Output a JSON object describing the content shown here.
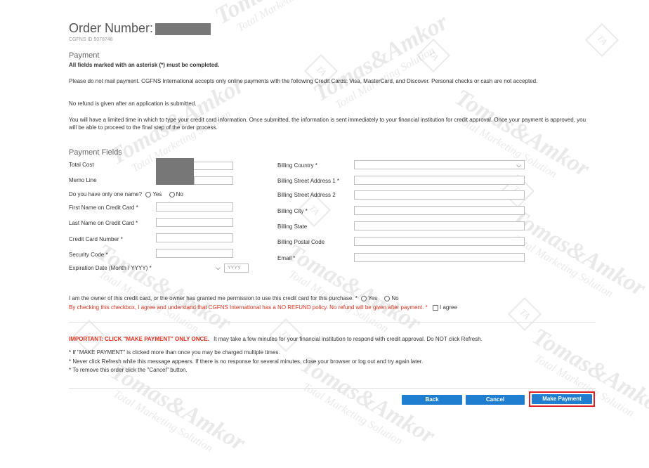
{
  "order": {
    "title": "Order Number:",
    "cgfns_id": "CGFNS ID 5078748"
  },
  "payment": {
    "heading": "Payment",
    "asterisk_note": "All fields marked with an asterisk (*) must be completed.",
    "para1": "Please do not mail payment. CGFNS International accepts only online payments with the following Credit Cards: Visa, MasterCard, and Discover. Personal checks or cash are not accepted.",
    "para2": "No refund is given after an application is submitted.",
    "para3": "You will have a limited time in which to type your credit card information.  Once submitted, the information is sent immediately to your financial institution for credit approval.  Once your payment is approved, you will be able to proceed to the final step of the order process."
  },
  "fields": {
    "heading": "Payment Fields",
    "total_cost": "Total Cost",
    "memo_line": "Memo Line",
    "one_name_q": "Do you have only one name?",
    "yes": "Yes",
    "no": "No",
    "first_name": "First Name on Credit Card *",
    "last_name": "Last Name on Credit Card *",
    "card_number": "Credit Card Number *",
    "security_code": "Security Code *",
    "expiration": "Expiration Date (Month / YYYY) *",
    "year_placeholder": "YYYY",
    "billing_country": "Billing Country *",
    "billing_street1": "Billing Street Address 1 *",
    "billing_street2": "Billing Street Address 2",
    "billing_city": "Billing City *",
    "billing_state": "Billing State",
    "billing_postal": "Billing Postal Code",
    "email": "Email *"
  },
  "owner": {
    "statement": "I am the owner of this credit card, or the owner has granted me permission to use this credit card for this purchase. *",
    "yes": "Yes",
    "no": "No",
    "refund_agree": "By checking this checkbox, I agree and understand that CGFNS International has a NO REFUND policy. No refund will be given after payment. *",
    "i_agree": "I agree"
  },
  "important": {
    "label": "IMPORTANT: CLICK \"MAKE PAYMENT\" ONLY ONCE.",
    "text": "It may take a few minutes for your financial institution to respond with credit approval.  Do NOT click Refresh.",
    "bullet1": "* If \"MAKE PAYMENT\" is clicked more than once you may be charged multiple times.",
    "bullet2": "* Never click Refresh while this message appears.  If there is no response for several minutes, close your browser or log out and try again later.",
    "bullet3": "* To remove this order click the \"Cancel\" button."
  },
  "buttons": {
    "back": "Back",
    "cancel": "Cancel",
    "make_payment": "Make Payment"
  },
  "watermark": {
    "brand": "Tomas&Amkor",
    "tagline": "Total Marketing Solution",
    "monogram": "TA"
  },
  "colors": {
    "button_blue": "#1f7ed0",
    "highlight_red": "#e02020",
    "warning_red": "#e0301e"
  }
}
